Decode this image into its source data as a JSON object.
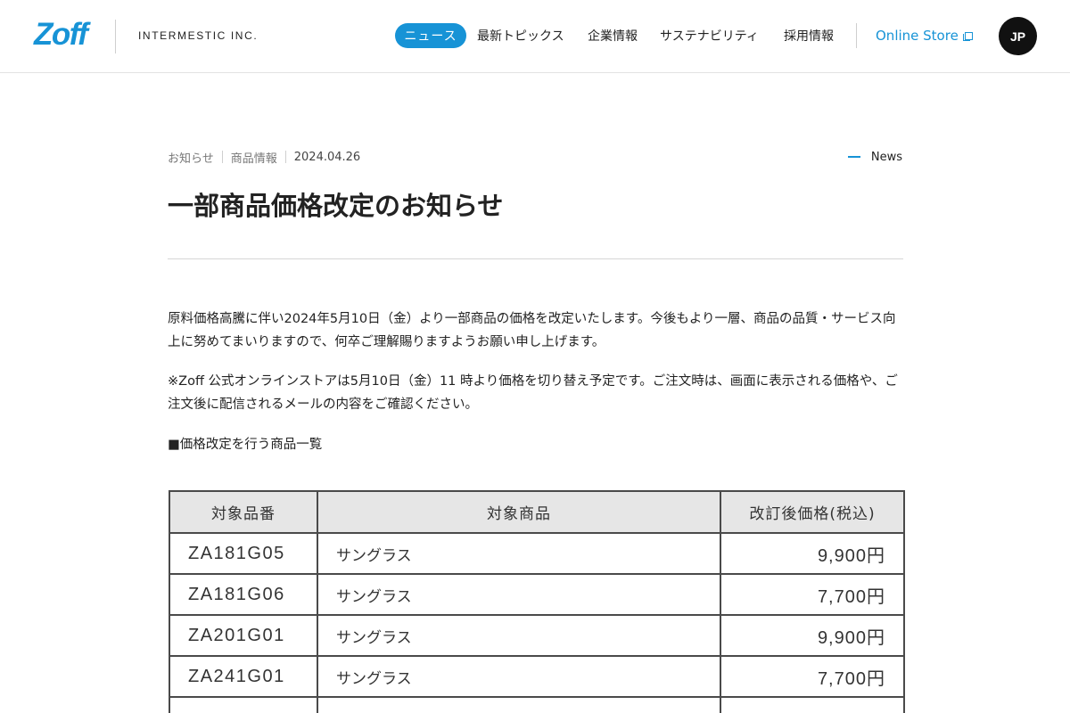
{
  "header": {
    "logo": "Zoff",
    "company": "INTERMESTIC INC.",
    "nav": {
      "news": "ニュース",
      "topics": "最新トピックス",
      "corporate": "企業情報",
      "sustainability": "サステナビリティ",
      "recruit": "採用情報"
    },
    "online_store": "Online Store",
    "language": "JP",
    "accent_color": "#1793d6"
  },
  "article": {
    "category_1": "お知らせ",
    "category_2": "商品情報",
    "date": "2024.04.26",
    "section_link": "News",
    "title": "一部商品価格改定のお知らせ",
    "paragraph_1": "原料価格高騰に伴い2024年5月10日（金）より一部商品の価格を改定いたします。今後もより一層、商品の品質・サービス向上に努めてまいりますので、何卒ご理解賜りますようお願い申し上げます。",
    "paragraph_2": "※Zoff 公式オンラインストアは5月10日（金）11 時より価格を切り替え予定です。ご注文時は、画面に表示される価格や、ご注文後に配信されるメールの内容をご確認ください。",
    "list_heading": "■価格改定を行う商品一覧"
  },
  "table": {
    "headers": [
      "対象品番",
      "対象商品",
      "改訂後価格(税込)"
    ],
    "rows": [
      [
        "ZA181G05",
        "サングラス",
        "9,900円"
      ],
      [
        "ZA181G06",
        "サングラス",
        "7,700円"
      ],
      [
        "ZA201G01",
        "サングラス",
        "9,900円"
      ],
      [
        "ZA241G01",
        "サングラス",
        "7,700円"
      ],
      [
        "",
        "",
        ""
      ]
    ]
  }
}
